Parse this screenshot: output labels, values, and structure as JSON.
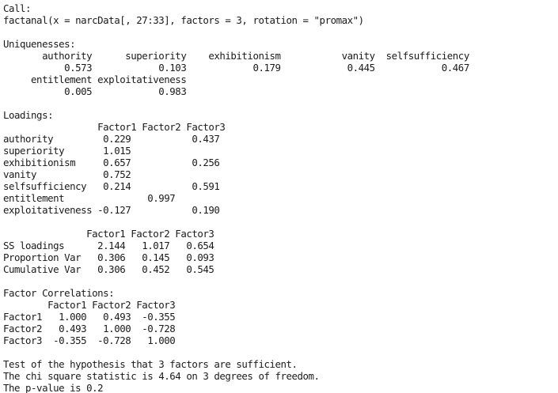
{
  "console": {
    "lines": [
      "Call:",
      "factanal(x = narcData[, 27:33], factors = 3, rotation = \"promax\")",
      "",
      "Uniquenesses:",
      "       authority      superiority    exhibitionism           vanity  selfsufficiency",
      "           0.573            0.103            0.179            0.445            0.467",
      "     entitlement exploitativeness",
      "           0.005            0.983",
      "",
      "Loadings:",
      "                 Factor1 Factor2 Factor3",
      "authority         0.229           0.437 ",
      "superiority       1.015                 ",
      "exhibitionism     0.657           0.256 ",
      "vanity            0.752                 ",
      "selfsufficiency   0.214           0.591 ",
      "entitlement               0.997         ",
      "exploitativeness -0.127           0.190 ",
      "",
      "               Factor1 Factor2 Factor3",
      "SS loadings      2.144   1.017   0.654",
      "Proportion Var   0.306   0.145   0.093",
      "Cumulative Var   0.306   0.452   0.545",
      "",
      "Factor Correlations:",
      "        Factor1 Factor2 Factor3",
      "Factor1   1.000   0.493  -0.355",
      "Factor2   0.493   1.000  -0.728",
      "Factor3  -0.355  -0.728   1.000",
      "",
      "Test of the hypothesis that 3 factors are sufficient.",
      "The chi square statistic is 4.64 on 3 degrees of freedom.",
      "The p-value is 0.2"
    ]
  }
}
